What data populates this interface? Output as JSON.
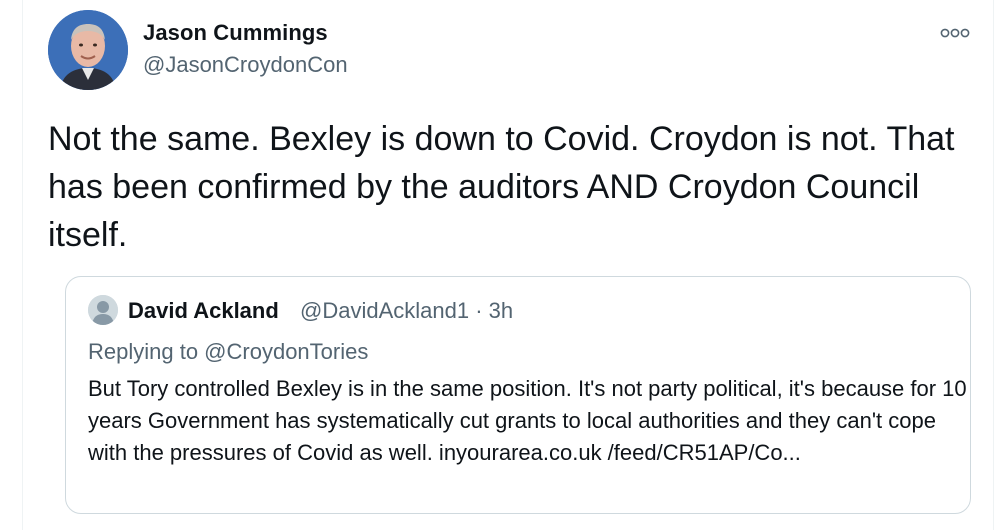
{
  "tweet": {
    "author_name": "Jason Cummings",
    "author_handle": "@JasonCroydonCon",
    "more_icon": "more-horizontal-icon",
    "text": "Not the same. Bexley is down to Covid. Croydon is not. That has been confirmed by the auditors AND Croydon Council itself."
  },
  "quoted_tweet": {
    "author_name": "David Ackland",
    "author_handle": "@DavidAckland1",
    "separator": "·",
    "time": "3h",
    "replying_to": "Replying to @CroydonTories",
    "text": "But Tory controlled Bexley is in the same position. It's not party political, it's because for 10 years Government has systematically cut grants to local authorities and they can't cope with the pressures of Covid as well.  inyourarea.co.uk /feed/CR51AP/Co..."
  },
  "colors": {
    "text_primary": "#0f1419",
    "text_secondary": "#536471",
    "border": "#cfd9de",
    "avatar_bg": "#3c6fb8"
  }
}
